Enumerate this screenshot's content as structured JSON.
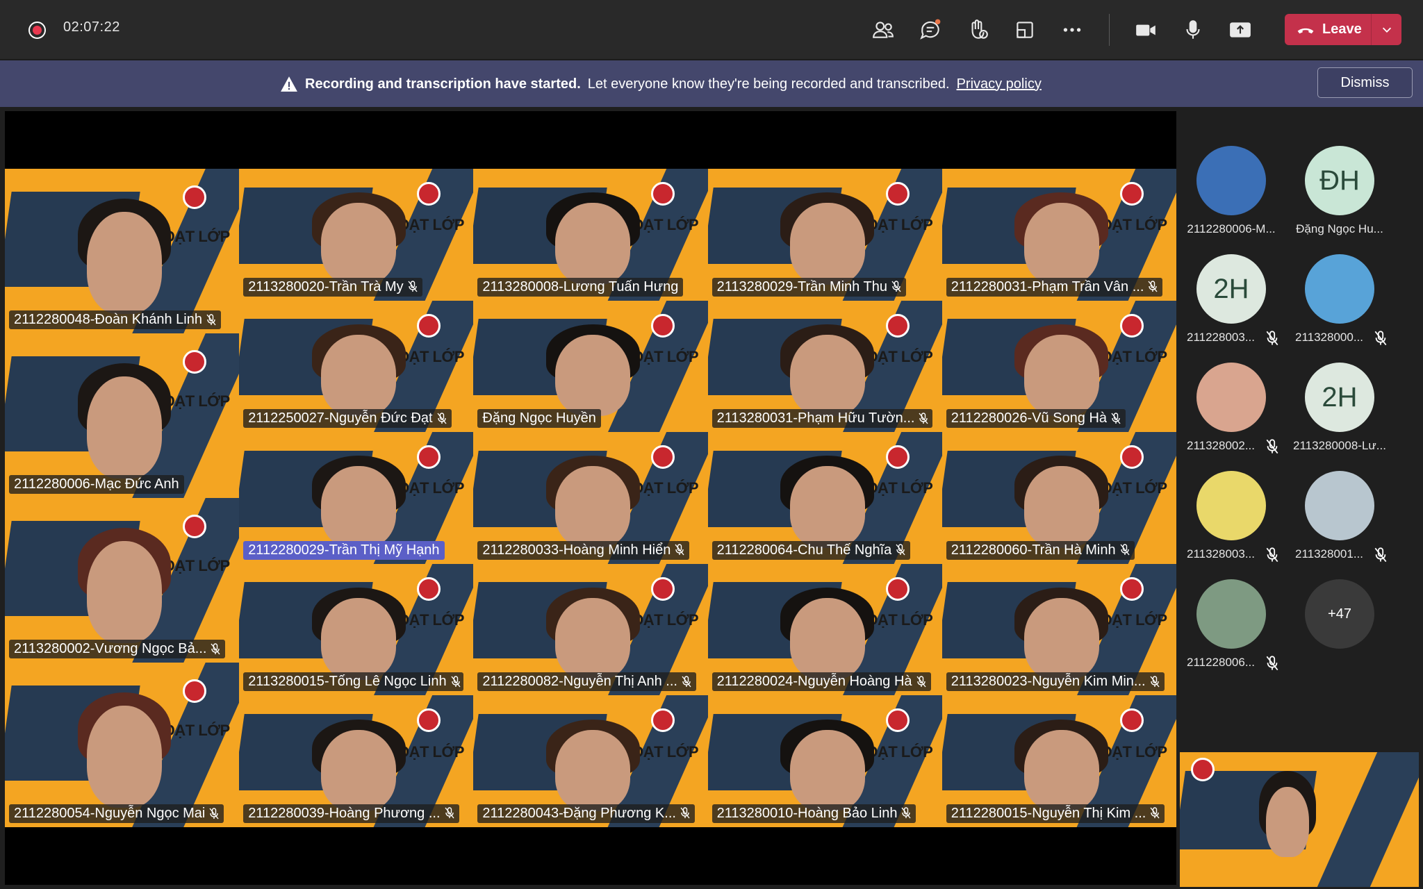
{
  "top_bar": {
    "timer": "02:07:22",
    "leave_label": "Leave"
  },
  "banner": {
    "title": "Recording and transcription have started.",
    "message": "Let everyone know they're being recorded and transcribed.",
    "link": "Privacy policy",
    "dismiss": "Dismiss"
  },
  "participants": [
    {
      "name": "2112280048-Đoàn Khánh Linh",
      "muted": true
    },
    {
      "name": "2113280020-Trần Trà My",
      "muted": true
    },
    {
      "name": "2113280008-Lương Tuấn Hưng",
      "muted": false
    },
    {
      "name": "2113280029-Trần Minh Thu",
      "muted": true
    },
    {
      "name": "2112280031-Phạm Trần Vân ...",
      "muted": true
    },
    {
      "name": "2112280006-Mạc Đức Anh",
      "muted": false
    },
    {
      "name": "2112250027-Nguyễn Đức Đạt",
      "muted": true
    },
    {
      "name": "Đặng Ngọc Huyền",
      "muted": false
    },
    {
      "name": "2113280031-Phạm Hữu Tườn...",
      "muted": true
    },
    {
      "name": "2112280026-Vũ Song Hà",
      "muted": true
    },
    {
      "name": "2112280029-Trần Thị Mỹ Hạnh",
      "muted": false,
      "highlight": true
    },
    {
      "name": "2112280033-Hoàng Minh Hiển",
      "muted": true
    },
    {
      "name": "2112280064-Chu Thế Nghĩa",
      "muted": true
    },
    {
      "name": "2112280060-Trần Hà Minh",
      "muted": true
    },
    {
      "name": "2113280002-Vương Ngọc Bả...",
      "muted": true
    },
    {
      "name": "2113280015-Tống Lê Ngọc Linh",
      "muted": true
    },
    {
      "name": "2112280082-Nguyễn Thị Anh ...",
      "muted": true
    },
    {
      "name": "2112280024-Nguyễn Hoàng Hà",
      "muted": true
    },
    {
      "name": "2113280023-Nguyễn Kim Min...",
      "muted": true
    },
    {
      "name": "2112280054-Nguyễn Ngọc Mai",
      "muted": true
    },
    {
      "name": "2112280039-Hoàng Phương ...",
      "muted": true
    },
    {
      "name": "2112280043-Đặng Phương K...",
      "muted": true
    },
    {
      "name": "2113280010-Hoàng Bảo Linh",
      "muted": true
    },
    {
      "name": "2112280015-Nguyễn Thị Kim ...",
      "muted": true
    }
  ],
  "tile_banner_text": "SINH HOẠT LỚP",
  "side_panel": [
    {
      "label": "2112280006-M...",
      "initials": "",
      "muted": false,
      "color": "#3b6fb6"
    },
    {
      "label": "Đặng Ngọc Hu...",
      "initials": "ĐH",
      "muted": false,
      "color": "#c9e6d6"
    },
    {
      "label": "211228003...",
      "initials": "2H",
      "muted": true,
      "color": "#dde8df"
    },
    {
      "label": "211328000...",
      "initials": "",
      "muted": true,
      "color": "#58a3d8"
    },
    {
      "label": "211328002...",
      "initials": "",
      "muted": true,
      "color": "#d9a58f"
    },
    {
      "label": "2113280008-Lư...",
      "initials": "2H",
      "muted": false,
      "color": "#dde8df"
    },
    {
      "label": "211328003...",
      "initials": "",
      "muted": true,
      "color": "#e9d86a"
    },
    {
      "label": "211328001...",
      "initials": "",
      "muted": true,
      "color": "#b8c6cf"
    },
    {
      "label": "211228006...",
      "initials": "",
      "muted": true,
      "color": "#7e9a82"
    },
    {
      "label": "",
      "initials": "+47",
      "muted": false,
      "color": "#3a3a3a"
    }
  ],
  "colors": {
    "leave": "#c4314b",
    "banner_bg": "#44476c",
    "tile_bg": "#f4a522",
    "highlight": "#5b5fc7"
  }
}
